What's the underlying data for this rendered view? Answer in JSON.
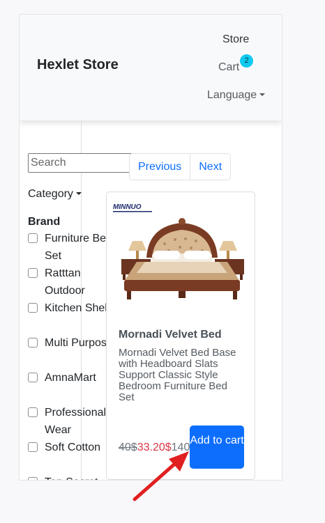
{
  "navbar": {
    "brand": "Hexlet Store",
    "store": "Store",
    "cart": "Cart",
    "cart_count": "2",
    "language": "Language"
  },
  "filters": {
    "search_placeholder": "Search",
    "category_label": "Category",
    "brand_title": "Brand",
    "brands": [
      "Furniture Bed Set",
      "Ratttan Outdoor",
      "Kitchen Shelf",
      "Multi Purpose",
      "AmnaMart",
      "Professional Wear",
      "Soft Cotton",
      "Top Secret"
    ]
  },
  "pagination": {
    "previous": "Previous",
    "next": "Next"
  },
  "product": {
    "logo_text": "MINNUO",
    "title": "Mornadi Velvet Bed",
    "description": "Mornadi Velvet Bed Base with Headboard Slats Support Classic Style Bedroom Furniture Bed Set",
    "old_price": "40$",
    "sale_price": "33.20$",
    "current_price": "140",
    "add_to_cart": "Add to cart"
  },
  "colors": {
    "primary": "#0d6efd",
    "badge": "#0dcaf0",
    "sale": "#dc3545",
    "annotation_arrow": "#e02020"
  },
  "icons": {
    "caret": "caret-down-icon",
    "arrow": "red-arrow-annotation"
  }
}
